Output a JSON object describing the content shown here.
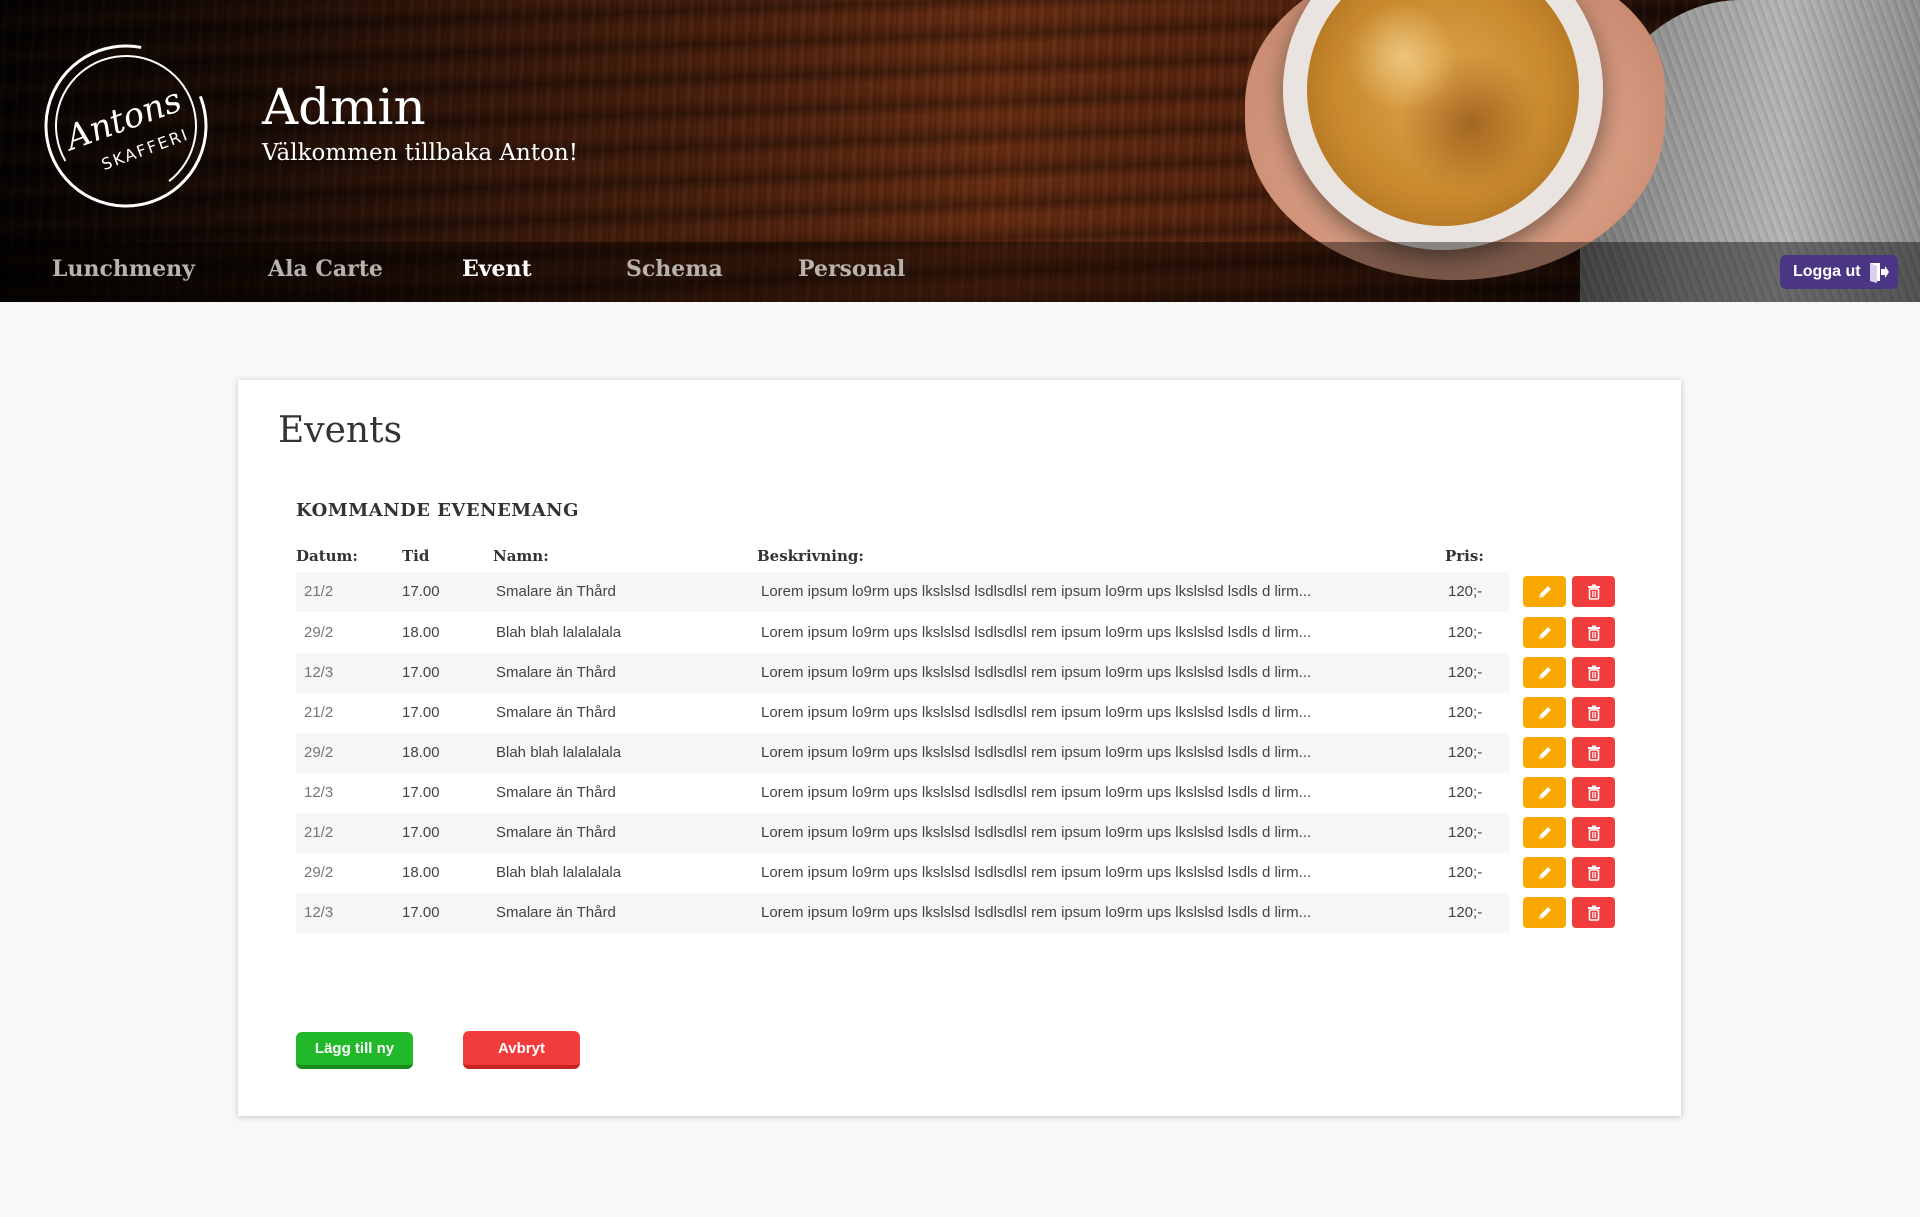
{
  "header": {
    "logo_top": "Antons",
    "logo_bottom": "SKAFFERI",
    "title": "Admin",
    "subtitle": "Välkommen tillbaka Anton!",
    "nav": [
      {
        "label": "Lunchmeny",
        "active": false
      },
      {
        "label": "Ala Carte",
        "active": false
      },
      {
        "label": "Event",
        "active": true
      },
      {
        "label": "Schema",
        "active": false
      },
      {
        "label": "Personal",
        "active": false
      }
    ],
    "logout_label": "Logga ut",
    "logout_icon": "logout-icon"
  },
  "main": {
    "page_title": "Events",
    "section_title": "KOMMANDE EVENEMANG",
    "columns": {
      "date": "Datum:",
      "time": "Tid",
      "name": "Namn:",
      "description": "Beskrivning:",
      "price": "Pris:"
    },
    "rows": [
      {
        "date": "21/2",
        "time": "17.00",
        "name": "Smalare än Thård",
        "description": "Lorem ipsum lo9rm ups lkslslsd lsdlsdlsl rem ipsum lo9rm ups lkslslsd lsdls d lirm...",
        "price": "120;-"
      },
      {
        "date": "29/2",
        "time": "18.00",
        "name": "Blah blah lalalalala",
        "description": "Lorem ipsum lo9rm ups lkslslsd lsdlsdlsl rem ipsum lo9rm ups lkslslsd lsdls d lirm...",
        "price": "120;-"
      },
      {
        "date": "12/3",
        "time": "17.00",
        "name": "Smalare än Thård",
        "description": "Lorem ipsum lo9rm ups lkslslsd lsdlsdlsl rem ipsum lo9rm ups lkslslsd lsdls d lirm...",
        "price": "120;-"
      },
      {
        "date": "21/2",
        "time": "17.00",
        "name": "Smalare än Thård",
        "description": "Lorem ipsum lo9rm ups lkslslsd lsdlsdlsl rem ipsum lo9rm ups lkslslsd lsdls d lirm...",
        "price": "120;-"
      },
      {
        "date": "29/2",
        "time": "18.00",
        "name": "Blah blah lalalalala",
        "description": "Lorem ipsum lo9rm ups lkslslsd lsdlsdlsl rem ipsum lo9rm ups lkslslsd lsdls d lirm...",
        "price": "120;-"
      },
      {
        "date": "12/3",
        "time": "17.00",
        "name": "Smalare än Thård",
        "description": "Lorem ipsum lo9rm ups lkslslsd lsdlsdlsl rem ipsum lo9rm ups lkslslsd lsdls d lirm...",
        "price": "120;-"
      },
      {
        "date": "21/2",
        "time": "17.00",
        "name": "Smalare än Thård",
        "description": "Lorem ipsum lo9rm ups lkslslsd lsdlsdlsl rem ipsum lo9rm ups lkslslsd lsdls d lirm...",
        "price": "120;-"
      },
      {
        "date": "29/2",
        "time": "18.00",
        "name": "Blah blah lalalalala",
        "description": "Lorem ipsum lo9rm ups lkslslsd lsdlsdlsl rem ipsum lo9rm ups lkslslsd lsdls d lirm...",
        "price": "120;-"
      },
      {
        "date": "12/3",
        "time": "17.00",
        "name": "Smalare än Thård",
        "description": "Lorem ipsum lo9rm ups lkslslsd lsdlsdlsl rem ipsum lo9rm ups lkslslsd lsdls d lirm...",
        "price": "120;-"
      }
    ],
    "row_actions": {
      "edit_icon": "pencil-icon",
      "delete_icon": "trash-icon"
    },
    "add_label": "Lägg till ny",
    "cancel_label": "Avbryt"
  },
  "colors": {
    "accent": "#4b3585",
    "edit": "#f9a800",
    "delete": "#f03c3c",
    "add": "#21b82a",
    "cancel": "#f23b3b"
  }
}
